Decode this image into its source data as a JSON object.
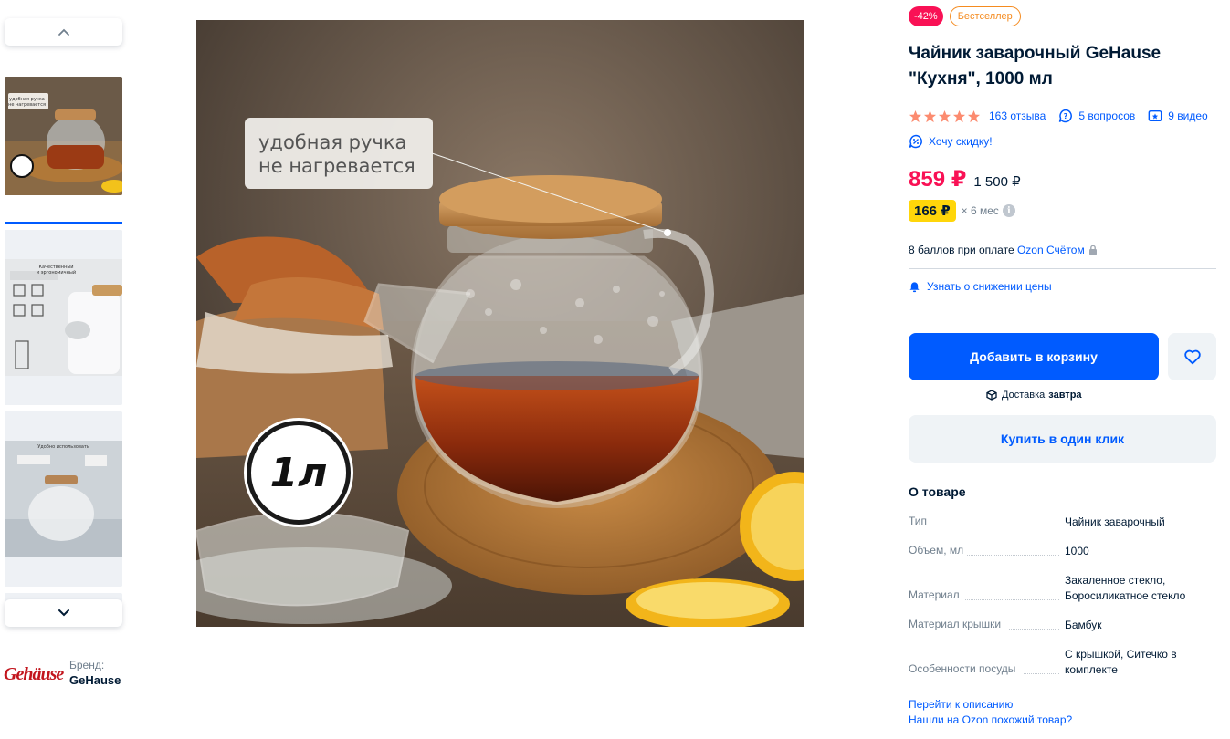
{
  "gallery": {
    "thumbs": [
      {
        "caption": "удобная ручка\nне нагревается",
        "badge": "1л"
      },
      {
        "caption": "Качественный\nи эргономичный"
      },
      {
        "caption": "Удобно использовать"
      },
      {
        "caption": ""
      }
    ]
  },
  "brand": {
    "label": "Бренд:",
    "name": "GeHause",
    "logo_text": "Gehäuse"
  },
  "hero": {
    "callout_line1": "удобная ручка",
    "callout_line2": "не нагревается",
    "volume_badge": "1л"
  },
  "product": {
    "badge_discount": "-42%",
    "badge_bestseller": "Бестселлер",
    "title": "Чайник заварочный GeHause \"Кухня\", 1000 мл",
    "rating_stars": 5,
    "reviews": "163 отзыва",
    "questions": "5 вопросов",
    "videos": "9 видео",
    "want_discount": "Хочу скидку!",
    "price": "859 ₽",
    "price_old": "1 500 ₽",
    "installment_amount": "166 ₽",
    "installment_term": "× 6 мес",
    "info_glyph": "i",
    "points_text": "8 баллов при оплате ",
    "points_link": "Ozon Счётом",
    "notify_price": "Узнать о снижении цены",
    "add_to_cart": "Добавить в корзину",
    "delivery_label": "Доставка",
    "delivery_when": "завтра",
    "buy_one_click": "Купить в один клик"
  },
  "about": {
    "title": "О товаре",
    "specs": [
      {
        "name": "Тип",
        "value": "Чайник заварочный"
      },
      {
        "name": "Объем, мл",
        "value": "1000"
      },
      {
        "name": "Материал",
        "value": "Закаленное стекло, Боросиликатное стекло"
      },
      {
        "name": "Материал крышки",
        "value": "Бамбук"
      },
      {
        "name": "Особенности посуды",
        "value": "С крышкой, Ситечко в комплекте"
      }
    ],
    "link_description": "Перейти к описанию",
    "link_similar": "Нашли на Ozon похожий товар?"
  },
  "colors": {
    "accent": "#005bff",
    "price": "#f91155",
    "bestseller": "#f58b1f",
    "installment": "#ffd60a",
    "star": "#fc8b6f"
  }
}
